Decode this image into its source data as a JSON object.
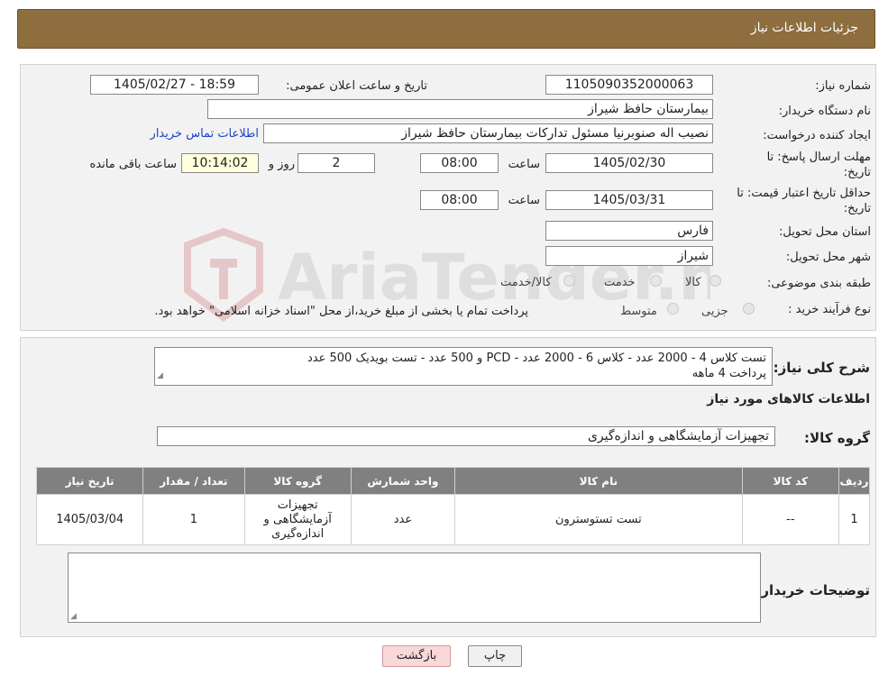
{
  "header": {
    "title": "جزئیات اطلاعات نیاز"
  },
  "form": {
    "need_number_label": "شماره نیاز:",
    "need_number": "1105090352000063",
    "announce_label": "تاریخ و ساعت اعلان عمومی:",
    "announce_value": "1405/02/27 - 18:59",
    "buyer_org_label": "نام دستگاه خریدار:",
    "buyer_org": "بیمارستان حافظ شیراز",
    "creator_label": "ایجاد کننده درخواست:",
    "creator": "نصیب اله صنوبرنیا مسئول تدارکات بیمارستان حافظ شیراز",
    "contact_link": "اطلاعات تماس خریدار",
    "reply_deadline_label_1": "مهلت ارسال پاسخ: تا",
    "reply_deadline_label_2": "تاریخ:",
    "reply_date": "1405/02/30",
    "time_label": "ساعت",
    "reply_time": "08:00",
    "days_value": "2",
    "days_label": "روز و",
    "remaining_time": "10:14:02",
    "remaining_label": "ساعت باقی مانده",
    "price_validity_label_1": "حداقل تاریخ اعتبار قیمت: تا",
    "price_validity_label_2": "تاریخ:",
    "price_date": "1405/03/31",
    "price_time": "08:00",
    "province_label": "استان محل تحویل:",
    "province": "فارس",
    "city_label": "شهر محل تحویل:",
    "city": "شیراز",
    "category_label": "طبقه بندی موضوعی:",
    "category_options": [
      "کالا",
      "خدمت",
      "کالا/خدمت"
    ],
    "process_label": "نوع فرآیند خرید :",
    "process_options": [
      "جزیی",
      "متوسط"
    ],
    "process_note": "پرداخت تمام یا بخشی از مبلغ خرید،از محل \"اسناد خزانه اسلامی\" خواهد بود."
  },
  "watermark_text": "AriaTender.neT",
  "description": {
    "label": "شرح کلی نیاز:",
    "line1": "تست کلاس 4 - 2000 عدد - کلاس 6  - 2000 عدد - PCD  و 500 عدد  - تست بویدیک 500 عدد",
    "line2": "پرداخت 4 ماهه"
  },
  "goods_section": {
    "title": "اطلاعات کالاهای مورد نیاز",
    "group_label": "گروه کالا:",
    "group_value": "تجهیزات آزمایشگاهی و اندازه‌گیری"
  },
  "table": {
    "headers": [
      "ردیف",
      "کد کالا",
      "نام کالا",
      "واحد شمارش",
      "گروه کالا",
      "تعداد / مقدار",
      "تاریخ نیاز"
    ],
    "rows": [
      {
        "row": "1",
        "code": "--",
        "name": "تست تستوسترون",
        "unit": "عدد",
        "group": "تجهیزات آزمایشگاهی و اندازه‌گیری",
        "qty": "1",
        "date": "1405/03/04"
      }
    ]
  },
  "notes": {
    "label": "توضیحات خریدار:"
  },
  "buttons": {
    "print": "چاپ",
    "back": "بازگشت"
  },
  "colors": {
    "header": "#8e6d3e",
    "table_header": "#808080",
    "link": "#1a44c9",
    "back_button": "#f8d8d8"
  }
}
